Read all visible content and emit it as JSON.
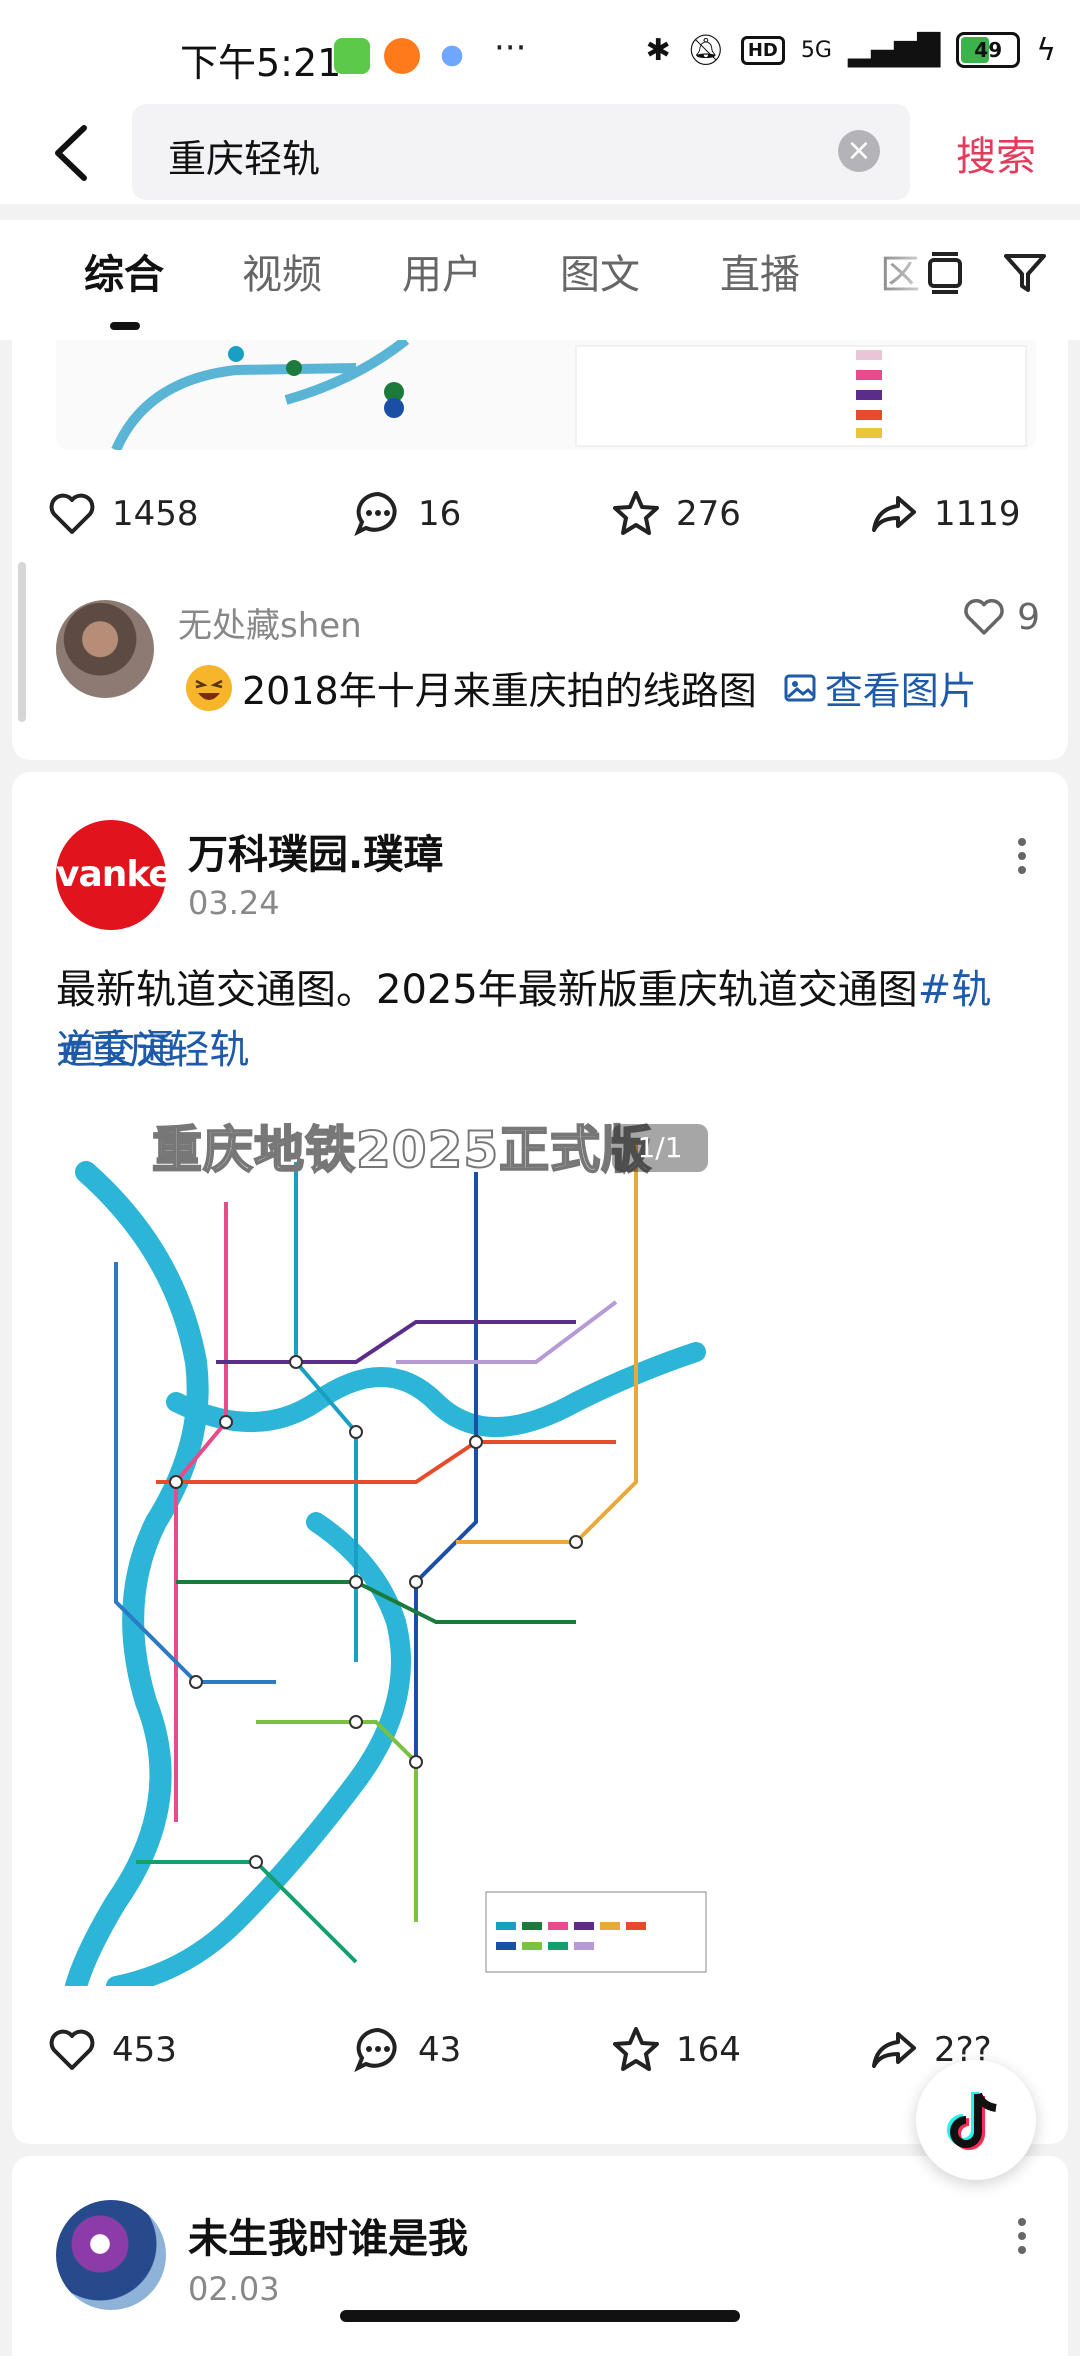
{
  "status_bar": {
    "time": "下午5:21",
    "network": "5G",
    "battery": "49",
    "hd": "HD"
  },
  "search": {
    "query": "重庆轻轨",
    "submit_label": "搜索"
  },
  "tabs": [
    {
      "label": "综合",
      "active": true
    },
    {
      "label": "视频"
    },
    {
      "label": "用户"
    },
    {
      "label": "图文"
    },
    {
      "label": "直播"
    },
    {
      "label": "区"
    }
  ],
  "card1": {
    "likes": "1458",
    "comments": "16",
    "favorites": "276",
    "shares": "1119",
    "top_comment": {
      "user": "无处藏shen",
      "likes": "9",
      "text": "2018年十月来重庆拍的线路图",
      "link_label": "查看图片"
    }
  },
  "card2": {
    "logo_text": "vanke",
    "author": "万科璞园.璞璋",
    "date": "03.24",
    "text_plain": "最新轨道交通图。2025年最新版重庆轨道交通图",
    "hashtag1": "#轨道交通",
    "hashtag2": "#重庆轻轨",
    "image_title": "重庆地铁2025正式版",
    "image_counter": "1/1",
    "likes": "453",
    "comments": "43",
    "favorites": "164",
    "shares": "2??"
  },
  "card3": {
    "author": "未生我时谁是我",
    "date": "02.03"
  },
  "colors": {
    "accent": "#e63a5a",
    "link": "#1e5aa8",
    "vanke_red": "#e1141e",
    "river": "#2cb5d6"
  }
}
